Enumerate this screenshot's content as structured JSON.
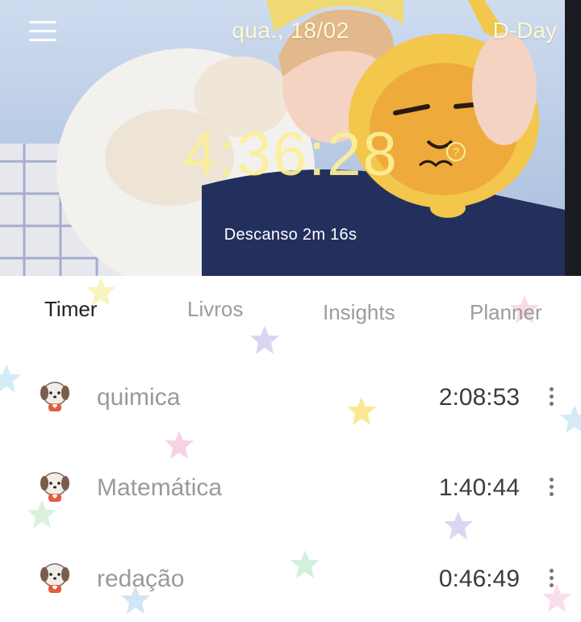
{
  "header": {
    "date": "qua., 18/02",
    "dday_label": "D-Day",
    "timer": "4:36:28",
    "break_text": "Descanso 2m 16s"
  },
  "tabs": [
    {
      "label": "Timer",
      "active": true
    },
    {
      "label": "Livros",
      "active": false
    },
    {
      "label": "Insights",
      "active": false
    },
    {
      "label": "Planner",
      "active": false
    }
  ],
  "subjects": [
    {
      "name": "quimica",
      "time": "2:08:53",
      "icon": "puppy-avatar-icon"
    },
    {
      "name": "Matemática",
      "time": "1:40:44",
      "icon": "puppy-avatar-icon"
    },
    {
      "name": "redação",
      "time": "0:46:49",
      "icon": "puppy-avatar-icon"
    }
  ],
  "colors": {
    "timer_text": "#fbf097",
    "tab_active": "#222222",
    "tab_inactive": "#9c9c9c",
    "subject_name": "#9a9a9a",
    "subject_time": "#3c3c3c"
  }
}
